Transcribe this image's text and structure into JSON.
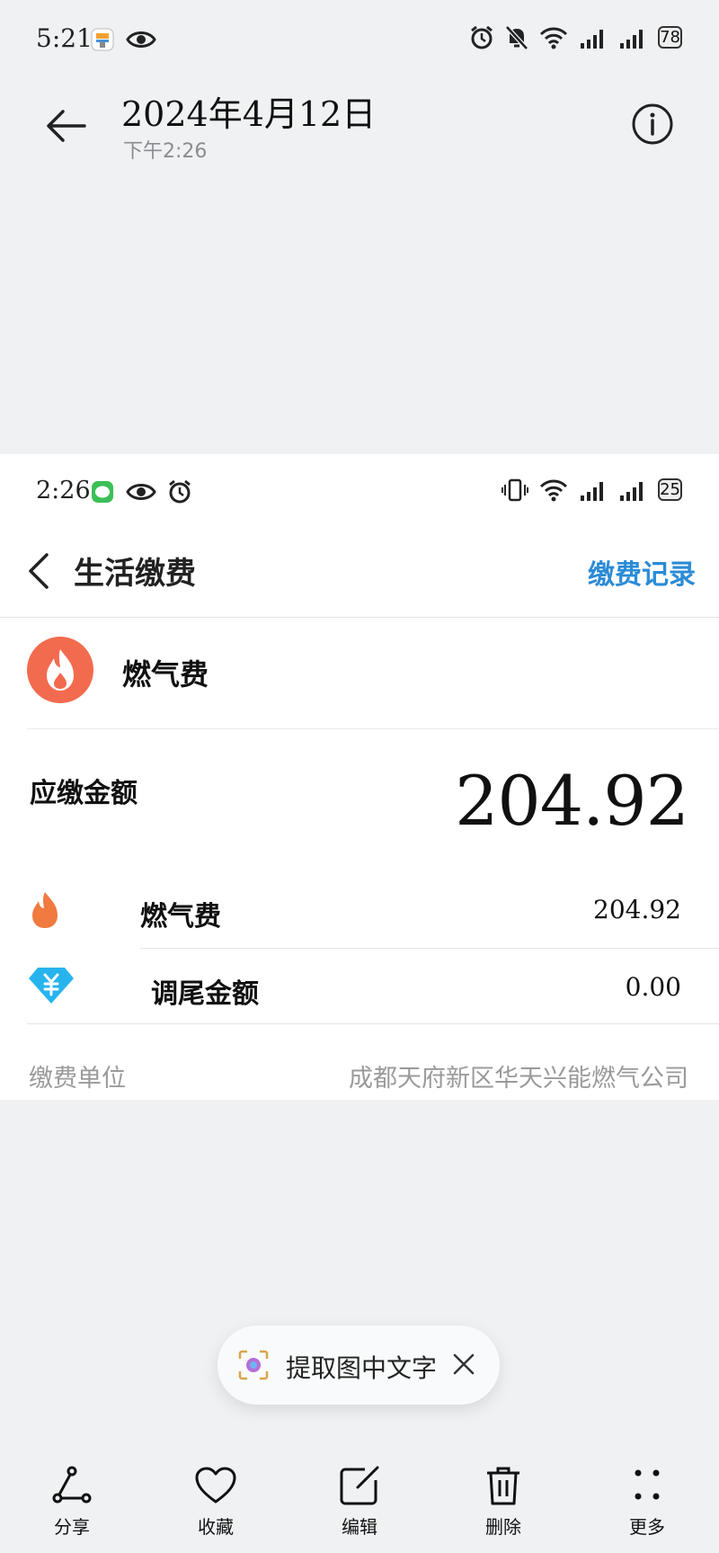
{
  "outer_status": {
    "time": "5:21",
    "battery": "78"
  },
  "viewer_header": {
    "date": "2024年4月12日",
    "time": "下午2:26"
  },
  "screenshot": {
    "status": {
      "time": "2:26",
      "battery": "25"
    },
    "nav": {
      "title": "生活缴费",
      "record_link": "缴费记录"
    },
    "biller": {
      "name": "燃气费"
    },
    "due": {
      "label": "应缴金额",
      "amount": "204.92"
    },
    "items": [
      {
        "label": "燃气费",
        "value": "204.92",
        "icon": "flame-icon"
      },
      {
        "label": "调尾金额",
        "value": "0.00",
        "icon": "diamond-yuan-icon"
      }
    ],
    "unit": {
      "label": "缴费单位",
      "value": "成都天府新区华天兴能燃气公司"
    }
  },
  "extract_pill": {
    "text": "提取图中文字"
  },
  "toolbar": {
    "share": "分享",
    "favorite": "收藏",
    "edit": "编辑",
    "delete": "删除",
    "more": "更多"
  },
  "colors": {
    "accent_link": "#2b8bd6",
    "gas_logo": "#f26b4f",
    "flame_icon": "#f07a40",
    "diamond_icon": "#27b4ee"
  }
}
